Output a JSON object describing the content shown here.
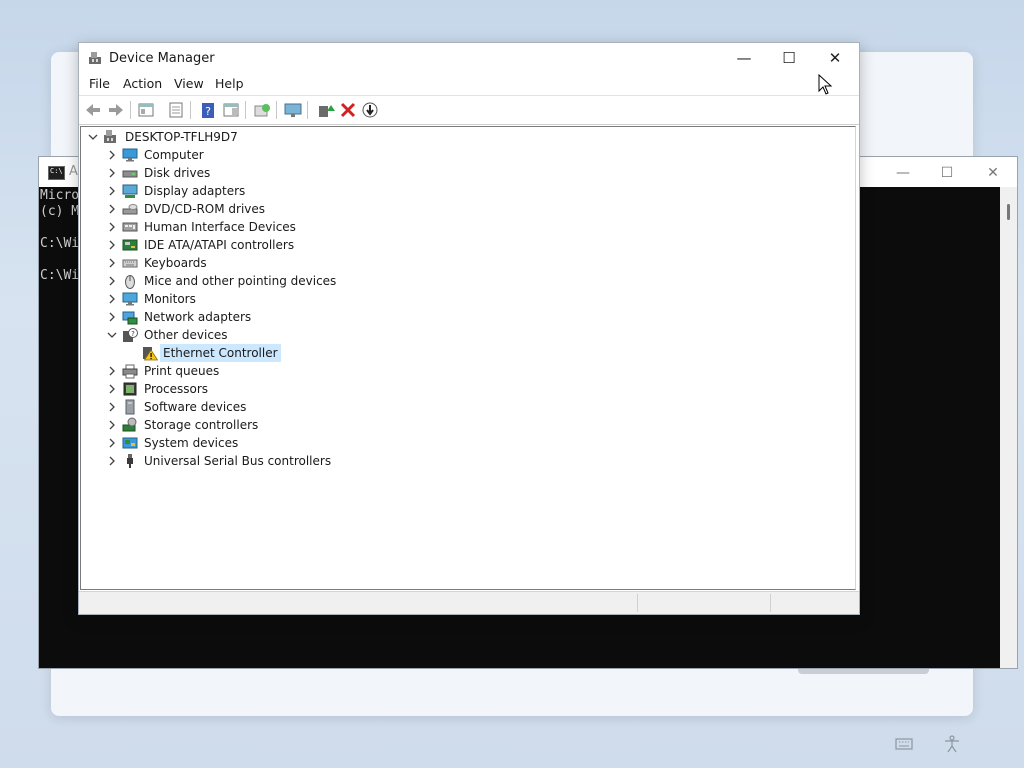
{
  "console": {
    "title": "Ac",
    "icon_label": "C:\\",
    "lines": [
      "Micro",
      "(c) M",
      "",
      "C:\\Wi",
      "",
      "C:\\Wi"
    ],
    "minimize": "—",
    "maximize": "☐",
    "close": "✕"
  },
  "device_manager": {
    "title": "Device Manager",
    "controls": {
      "minimize": "—",
      "maximize": "☐",
      "close": "✕"
    },
    "menu": [
      "File",
      "Action",
      "View",
      "Help"
    ],
    "toolbar": [
      "back-icon",
      "forward-icon",
      "show-hide-console-tree-icon",
      "properties-icon",
      "help-icon",
      "action-pane-icon",
      "scan-hardware-icon",
      "display-icon",
      "update-driver-icon",
      "uninstall-icon",
      "disable-device-icon"
    ],
    "tree": {
      "root": "DESKTOP-TFLH9D7",
      "categories": [
        {
          "label": "Computer",
          "icon": "computer-icon"
        },
        {
          "label": "Disk drives",
          "icon": "disk-drive-icon"
        },
        {
          "label": "Display adapters",
          "icon": "display-adapter-icon"
        },
        {
          "label": "DVD/CD-ROM drives",
          "icon": "dvd-drive-icon"
        },
        {
          "label": "Human Interface Devices",
          "icon": "hid-icon"
        },
        {
          "label": "IDE ATA/ATAPI controllers",
          "icon": "ide-controller-icon"
        },
        {
          "label": "Keyboards",
          "icon": "keyboard-icon"
        },
        {
          "label": "Mice and other pointing devices",
          "icon": "mouse-icon"
        },
        {
          "label": "Monitors",
          "icon": "monitor-icon"
        },
        {
          "label": "Network adapters",
          "icon": "network-adapter-icon"
        },
        {
          "label": "Other devices",
          "icon": "unknown-device-icon",
          "expanded": true,
          "children": [
            {
              "label": "Ethernet Controller",
              "icon": "warning-device-icon",
              "selected": true
            }
          ]
        },
        {
          "label": "Print queues",
          "icon": "printer-icon"
        },
        {
          "label": "Processors",
          "icon": "processor-icon"
        },
        {
          "label": "Software devices",
          "icon": "software-device-icon"
        },
        {
          "label": "Storage controllers",
          "icon": "storage-controller-icon"
        },
        {
          "label": "System devices",
          "icon": "system-device-icon"
        },
        {
          "label": "Universal Serial Bus controllers",
          "icon": "usb-icon"
        }
      ]
    }
  },
  "taskbar_tray": [
    "keyboard-tray-icon",
    "accessibility-tray-icon"
  ]
}
